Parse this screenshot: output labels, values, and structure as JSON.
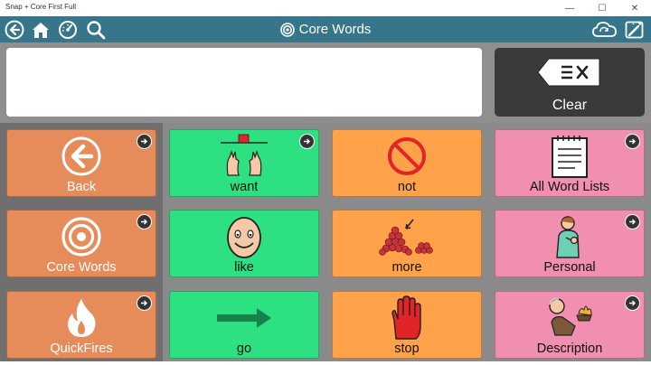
{
  "window": {
    "title": "Snap + Core First Full",
    "minimize": "—",
    "maximize": "☐",
    "close": "✕"
  },
  "toolbar": {
    "title": "Core Words",
    "accent": "#37758b"
  },
  "message": {
    "text": ""
  },
  "clear": {
    "label": "Clear"
  },
  "nav": [
    {
      "label": "Back",
      "icon": "back-arrow-icon",
      "color": "#e68c5a"
    },
    {
      "label": "Core Words",
      "icon": "target-icon",
      "color": "#e68c5a"
    },
    {
      "label": "QuickFires",
      "icon": "flame-icon",
      "color": "#e68c5a"
    }
  ],
  "cells": [
    {
      "label": "want",
      "icon": "want-icon",
      "color": "#2de082"
    },
    {
      "label": "not",
      "icon": "not-icon",
      "color": "#ffa24a"
    },
    {
      "label": "All Word Lists",
      "icon": "notepad-icon",
      "color": "#f08fb0"
    },
    {
      "label": "like",
      "icon": "smiling-face-icon",
      "color": "#2de082"
    },
    {
      "label": "more",
      "icon": "more-berries-icon",
      "color": "#ffa24a"
    },
    {
      "label": "Personal",
      "icon": "person-icon",
      "color": "#f08fb0"
    },
    {
      "label": "go",
      "icon": "go-arrow-icon",
      "color": "#2de082"
    },
    {
      "label": "stop",
      "icon": "stop-hand-icon",
      "color": "#ffa24a"
    },
    {
      "label": "Description",
      "icon": "description-icon",
      "color": "#f08fb0"
    }
  ]
}
